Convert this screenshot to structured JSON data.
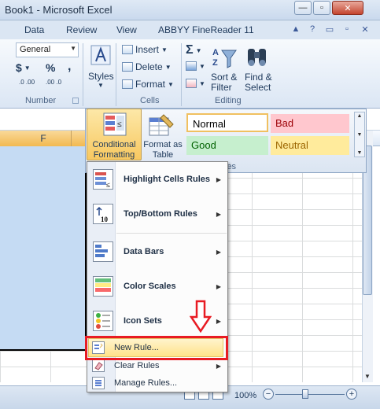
{
  "titlebar": {
    "title": "Book1 - Microsoft Excel",
    "minimize_glyph": "—",
    "maximize_glyph": "▫",
    "close_glyph": "✕"
  },
  "tabs": [
    "Data",
    "Review",
    "View",
    "ABBYY FineReader 11"
  ],
  "ribbon": {
    "number": {
      "format_value": "General",
      "currency_symbol": "$",
      "percent_symbol": "%",
      "comma_symbol": ",",
      "inc_decimal": ".0 .00",
      "dec_decimal": ".00 .0",
      "label": "Number"
    },
    "styles": {
      "label": "Styles"
    },
    "cells": {
      "insert": "Insert",
      "delete": "Delete",
      "format": "Format",
      "label": "Cells"
    },
    "editing": {
      "sum_glyph": "Σ",
      "sort_filter": "Sort & Filter",
      "find_select": "Find & Select",
      "label": "Editing"
    }
  },
  "styles_gallery": {
    "conditional_formatting": "Conditional Formatting",
    "format_as_table": "Format as Table",
    "normal": "Normal",
    "bad": "Bad",
    "good": "Good",
    "neutral": "Neutral",
    "group_label_fragment": "les"
  },
  "sheet": {
    "column_header": "F",
    "zoom": "100%",
    "zoom_minus": "−",
    "zoom_plus": "+"
  },
  "menu": {
    "items": [
      {
        "label": "Highlight Cells Rules",
        "has_submenu": true
      },
      {
        "label": "Top/Bottom Rules",
        "has_submenu": true
      },
      {
        "label": "Data Bars",
        "has_submenu": true
      },
      {
        "label": "Color Scales",
        "has_submenu": true
      },
      {
        "label": "Icon Sets",
        "has_submenu": true
      },
      {
        "label": "New Rule...",
        "has_submenu": false
      },
      {
        "label": "Clear Rules",
        "has_submenu": true
      },
      {
        "label": "Manage Rules...",
        "has_submenu": false
      }
    ]
  },
  "colors": {
    "highlight_box": "#e81b23",
    "ribbon_bg": "#dbe6f4",
    "selection": "#c5dbf3"
  }
}
